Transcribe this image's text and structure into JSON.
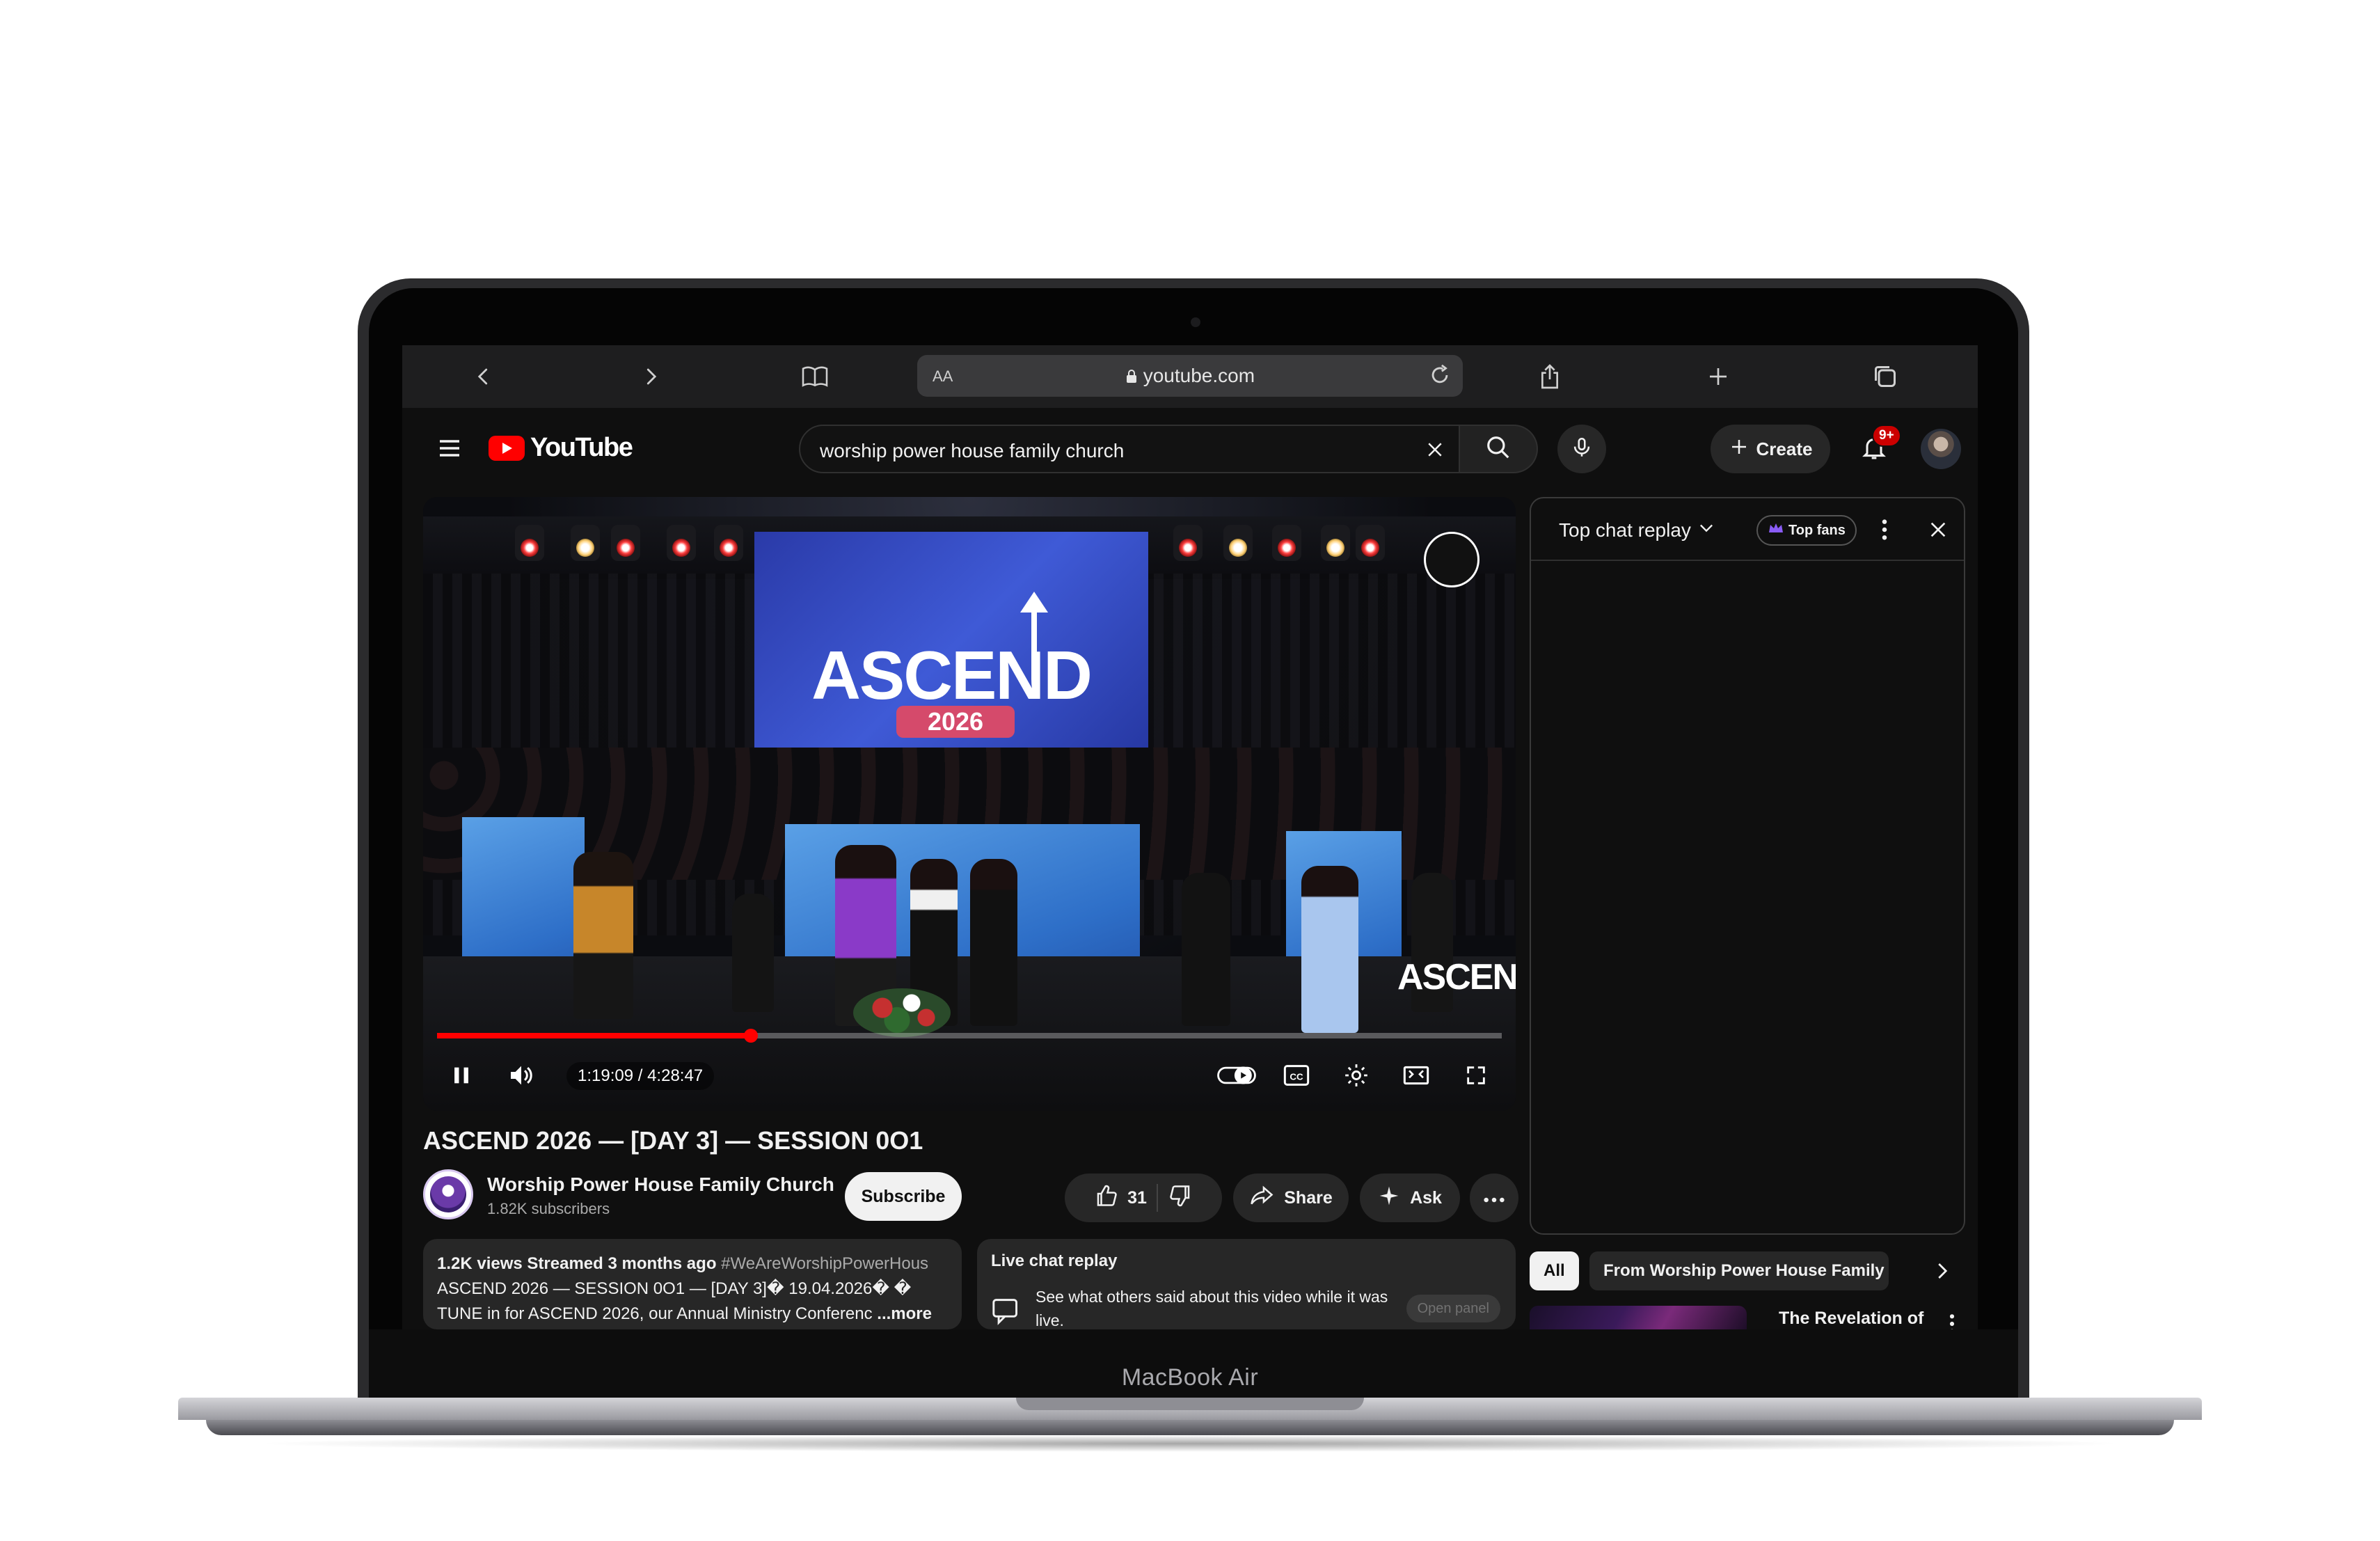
{
  "device": {
    "label": "MacBook Air"
  },
  "browser": {
    "text_size_label": "AA",
    "url": "youtube.com"
  },
  "youtube": {
    "logo_text": "YouTube",
    "search_query": "worship power house family church",
    "create_label": "Create",
    "notifications_badge": "9+",
    "brand_color": "#ff0000"
  },
  "video": {
    "time": "1:19:09 / 4:28:47",
    "progress_fraction": 0.295,
    "overlay_title": "ASCEND",
    "overlay_year": "2026",
    "title": "ASCEND 2026 — [DAY 3] — SESSION 0O1",
    "channel_name": "Worship Power House Family Church",
    "subscribers": "1.82K subscribers",
    "subscribe_label": "Subscribe",
    "likes": "31",
    "share_label": "Share",
    "ask_label": "Ask"
  },
  "description": {
    "meta": "1.2K views  Streamed 3 months ago",
    "hashtag": "#WeAreWorshipPowerHous",
    "line2": "ASCEND 2026 — SESSION 0O1 — [DAY 3]� 19.04.2026� �",
    "line3": "TUNE in for ASCEND 2026, our Annual Ministry Conferenc",
    "more": " ...more"
  },
  "live_chat_card": {
    "heading": "Live chat replay",
    "text": "See what others said about this video while it was live.",
    "button": "Open panel"
  },
  "chat_panel": {
    "title": "Top chat replay",
    "top_fans": "Top fans"
  },
  "chips": {
    "all": "All",
    "from_channel": "From Worship Power House Family Ch"
  },
  "recommendation": {
    "title": "The Revelation of"
  }
}
